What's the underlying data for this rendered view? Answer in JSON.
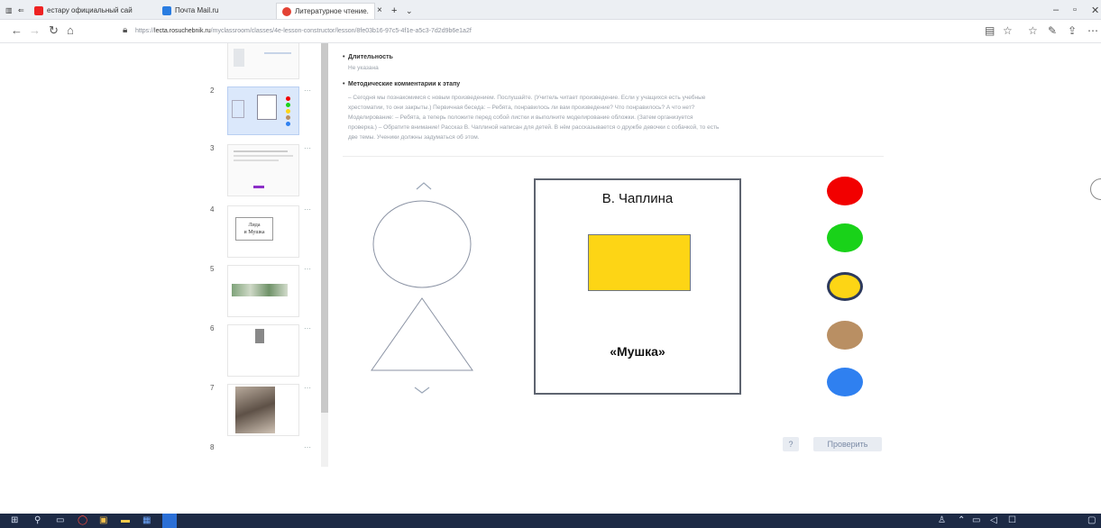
{
  "browser": {
    "tabs": [
      {
        "label": "естару официальный сай"
      },
      {
        "label": "Почта Mail.ru"
      },
      {
        "label": "Литературное чтение."
      }
    ],
    "url_prefix": "https://",
    "url_domain": "lecta.rosuchebnik.ru",
    "url_rest": "/myclassroom/classes/4e-lesson-constructor/lesson/8fe03b16-97c5-4f1e-a5c3-7d2d9b6e1a2f"
  },
  "slides": [
    {
      "num": "2"
    },
    {
      "num": "3"
    },
    {
      "num": "4",
      "thumb_text": "Лида\nи Мушка"
    },
    {
      "num": "5"
    },
    {
      "num": "6"
    },
    {
      "num": "7"
    },
    {
      "num": "8"
    }
  ],
  "stage": {
    "duration_heading": "Длительность",
    "duration_value": "Не указана",
    "comments_heading": "Методические комментарии к этапу",
    "comments_text_1": "– Сегодня мы познакомимся с новым произведением. Послушайте. (Учитель читает произведение. Если у учащихся есть учебные",
    "comments_text_2": "хрестоматии, то они закрыты.) Первичная беседа: – Ребята, понравилось ли вам произведение? Что понравилось? А что нет?",
    "comments_text_3": "Моделирование: – Ребята, а теперь положите перед собой листки и выполните моделирование обложки. (Затем организуется",
    "comments_text_4": "проверка.) – Обратите внимание! Рассказ В. Чаплиной написан для детей. В нём рассказывается о дружбе девочки с собачкой, то есть",
    "comments_text_5": "две темы. Ученики должны задуматься об этом."
  },
  "task": {
    "author": "В. Чаплина",
    "title": "«Мушка»",
    "rect_color": "#fdd515",
    "colors": [
      {
        "name": "red",
        "hex": "#f20000"
      },
      {
        "name": "green",
        "hex": "#19d219"
      },
      {
        "name": "yellow",
        "hex": "#fdd515",
        "selected": true
      },
      {
        "name": "brown",
        "hex": "#b98f63"
      },
      {
        "name": "blue",
        "hex": "#2f80f0"
      }
    ],
    "help_label": "?",
    "check_label": "Проверить"
  }
}
